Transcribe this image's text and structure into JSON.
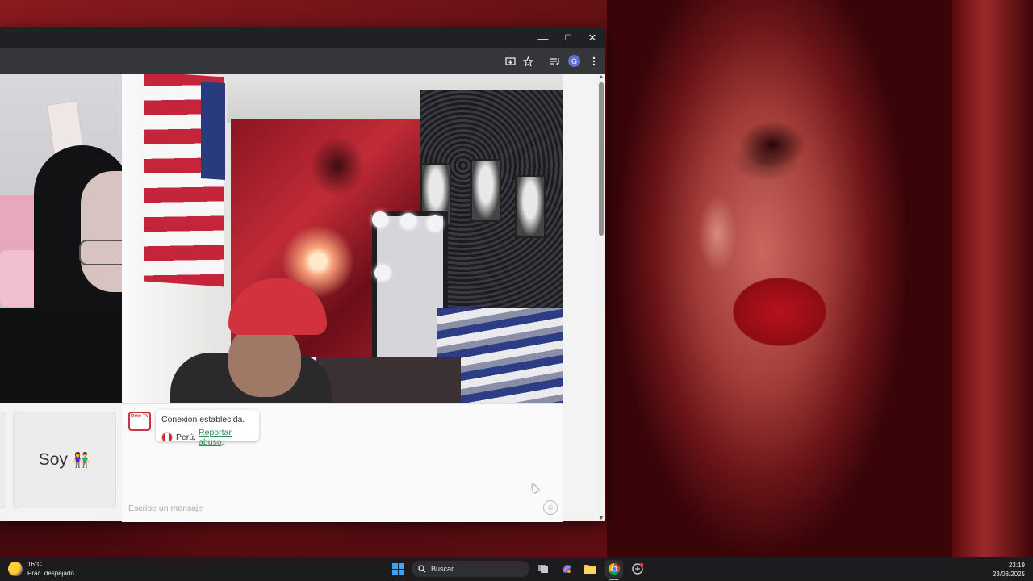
{
  "browser": {
    "window_controls": {
      "minimize": "—",
      "maximize": "☐",
      "close": "✕"
    },
    "toolbar_icons": [
      "install-app-icon",
      "bookmark-star-icon",
      "media-controls-icon",
      "profile-avatar",
      "menu-dots-icon"
    ],
    "profile_initial": "G"
  },
  "chat": {
    "logo_text": "Ome TV",
    "connection_message": "Conexión establecida.",
    "country": "Perú.",
    "report_link": "Reportar abuso",
    "report_suffix": ".",
    "input_placeholder": "Escribe un mensaje"
  },
  "card": {
    "label": "Soy",
    "emoji": "👫"
  },
  "taskbar": {
    "weather_temp": "16°C",
    "weather_desc": "Prac. despejado",
    "search_label": "Buscar",
    "time": "23:19",
    "date": "23/08/2025",
    "apps": [
      "start-button",
      "search-box",
      "task-view-icon",
      "copilot-icon",
      "file-explorer-icon",
      "chrome-icon",
      "extension-icon"
    ]
  },
  "colors": {
    "accent_link": "#2f8a55",
    "brand_red": "#c8343f"
  }
}
